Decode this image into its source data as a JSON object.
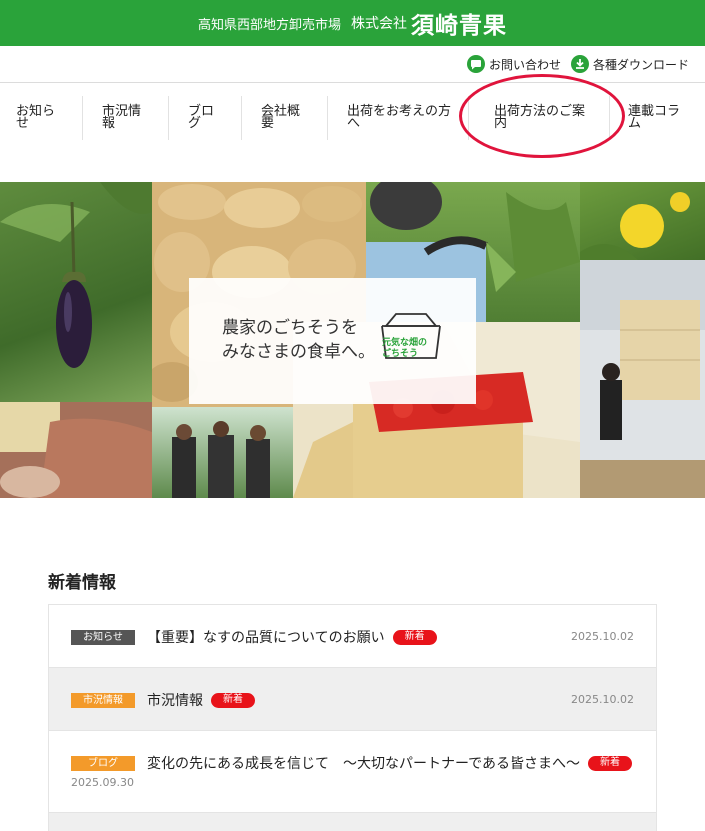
{
  "header": {
    "subtitle": "高知県西部地方卸売市場",
    "company_prefix": "株式会社",
    "company_name": "須崎青果",
    "brand_color": "#2aa33a"
  },
  "utility": {
    "contact_label": "お問い合わせ",
    "download_label": "各種ダウンロード",
    "contact_icon": "chat-icon",
    "download_icon": "download-icon"
  },
  "nav": {
    "items": [
      {
        "label": "お知らせ"
      },
      {
        "label": "市況情報"
      },
      {
        "label": "ブログ"
      },
      {
        "label": "会社概要"
      },
      {
        "label": "出荷をお考えの方へ"
      },
      {
        "label": "出荷方法のご案内"
      },
      {
        "label": "連載コラム"
      }
    ],
    "highlight_color": "#e0143c"
  },
  "hero": {
    "catch_line1": "農家のごちそうを",
    "catch_line2": "みなさまの食卓へ。",
    "logo_line1": "元気な畑の",
    "logo_line2": "ごちそう"
  },
  "news": {
    "section_title": "新着情報",
    "new_badge": "新着",
    "items": [
      {
        "category": "お知らせ",
        "title": "【重要】なすの品質についてのお願い",
        "date": "2025.10.02"
      },
      {
        "category": "市況情報",
        "title": "市況情報",
        "date": "2025.10.02"
      },
      {
        "category": "ブログ",
        "title": "変化の先にある成長を信じて　～大切なパートナーである皆さまへ～",
        "date": "2025.09.30"
      }
    ]
  }
}
